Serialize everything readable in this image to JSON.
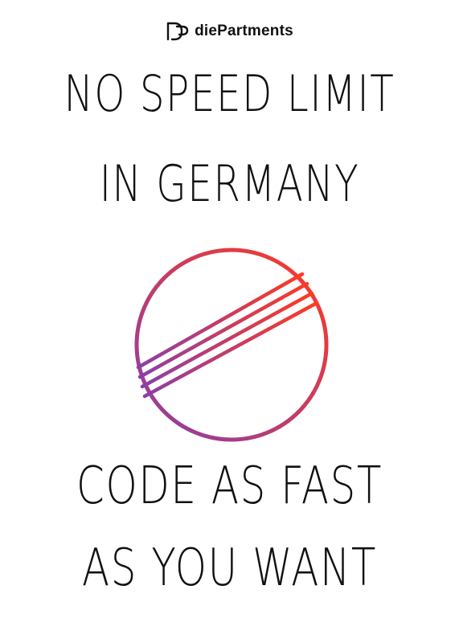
{
  "brand": {
    "name": "diePartments",
    "logo_icon": "brand-logo-icon"
  },
  "headline_top": {
    "line_1": "NO SPEED LIMIT",
    "line_2": "IN GERMANY"
  },
  "sign": {
    "icon": "end-of-speed-limit-sign-icon",
    "gradient_start": "#8a3fa8",
    "gradient_end": "#ff3a22"
  },
  "headline_bottom": {
    "line_1": "CODE AS FAST",
    "line_2": "AS YOU WANT"
  },
  "colors": {
    "background": "#ffffff",
    "text": "#111111"
  }
}
